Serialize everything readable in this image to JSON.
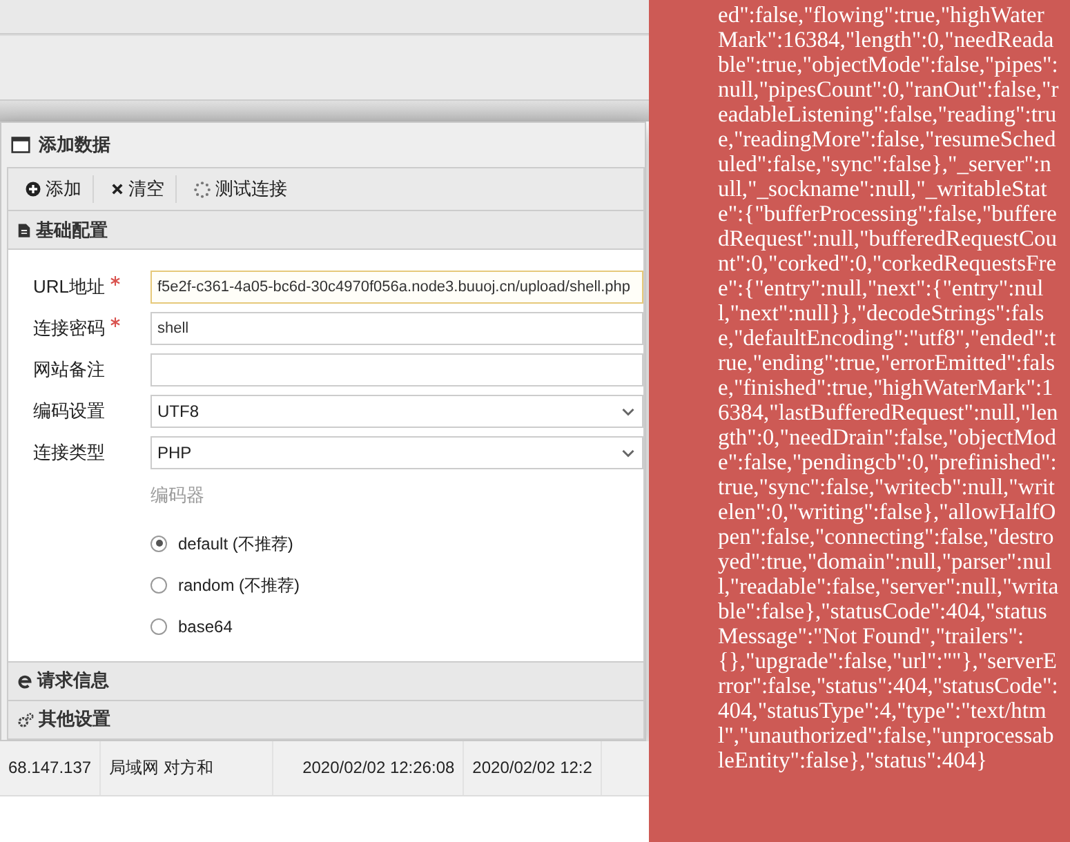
{
  "dialog": {
    "title": "添加数据",
    "toolbar": [
      {
        "label": "添加"
      },
      {
        "label": "清空"
      },
      {
        "label": "测试连接"
      }
    ],
    "sections": [
      {
        "title": "基础配置",
        "expanded": true
      },
      {
        "title": "请求信息",
        "expanded": false
      },
      {
        "title": "其他设置",
        "expanded": false
      }
    ],
    "fields": [
      {
        "kind": "text",
        "label": "URL地址",
        "required": true,
        "value": "f5e2f-c361-4a05-bc6d-30c4970f056a.node3.buuoj.cn/upload/shell.php"
      },
      {
        "kind": "text",
        "label": "连接密码",
        "required": true,
        "value": "shell"
      },
      {
        "kind": "text",
        "label": "网站备注",
        "required": false
      },
      {
        "kind": "select",
        "label": "编码设置",
        "required": false,
        "value": "UTF8"
      },
      {
        "kind": "select",
        "label": "连接类型",
        "required": false,
        "value": "PHP"
      }
    ],
    "encoder": {
      "label": "编码器",
      "options": [
        {
          "label": "default (不推荐)",
          "selected": true
        },
        {
          "label": "random (不推荐)",
          "selected": false
        },
        {
          "label": "base64",
          "selected": false
        }
      ]
    }
  },
  "background_row": [
    "68.147.137",
    "局域网 对方和",
    "2020/02/02 12:26:08",
    "2020/02/02 12:2"
  ],
  "error_toast": {
    "text": "ed\":false,\"flowing\":true,\"highWaterMark\":16384,\"length\":0,\"needReadable\":true,\"objectMode\":false,\"pipes\":null,\"pipesCount\":0,\"ranOut\":false,\"readableListening\":false,\"reading\":true,\"readingMore\":false,\"resumeScheduled\":false,\"sync\":false},\"_server\":null,\"_sockname\":null,\"_writableState\":{\"bufferProcessing\":false,\"bufferedRequest\":null,\"bufferedRequestCount\":0,\"corked\":0,\"corkedRequestsFree\":{\"entry\":null,\"next\":{\"entry\":null,\"next\":null}},\"decodeStrings\":false,\"defaultEncoding\":\"utf8\",\"ended\":true,\"ending\":true,\"errorEmitted\":false,\"finished\":true,\"highWaterMark\":16384,\"lastBufferedRequest\":null,\"length\":0,\"needDrain\":false,\"objectMode\":false,\"pendingcb\":0,\"prefinished\":true,\"sync\":false,\"writecb\":null,\"writelen\":0,\"writing\":false},\"allowHalfOpen\":false,\"connecting\":false,\"destroyed\":true,\"domain\":null,\"parser\":null,\"readable\":false,\"server\":null,\"writable\":false},\"statusCode\":404,\"statusMessage\":\"Not Found\",\"trailers\":{},\"upgrade\":false,\"url\":\"\"},\"serverError\":false,\"status\":404,\"statusCode\":404,\"statusType\":4,\"type\":\"text/html\",\"unauthorized\":false,\"unprocessableEntity\":false},\"status\":404}"
  }
}
